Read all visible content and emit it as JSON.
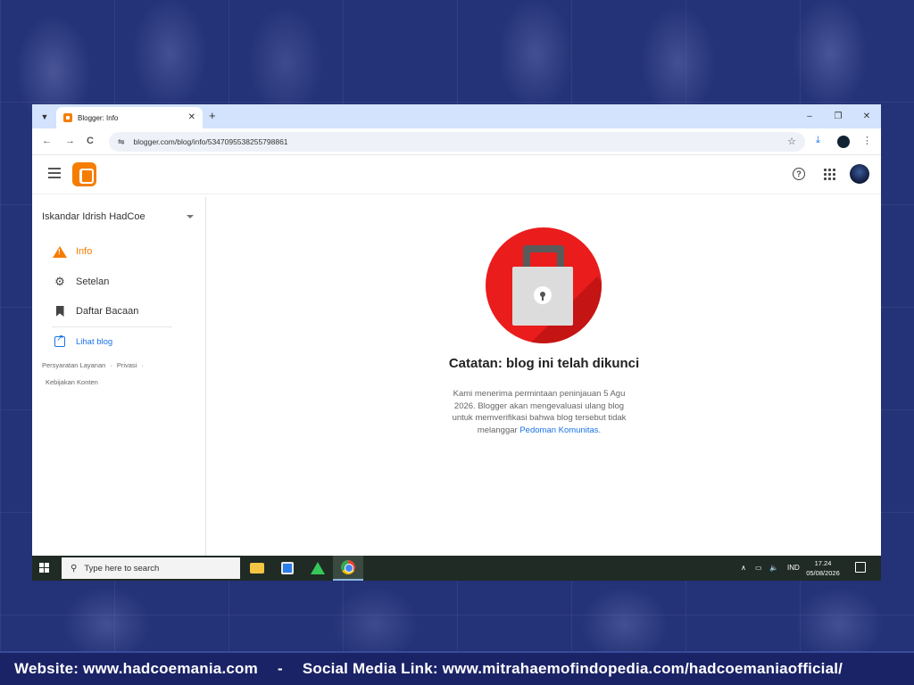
{
  "browser": {
    "tab_title": "Blogger: Info",
    "tab_close": "✕",
    "new_tab": "+",
    "url": "blogger.com/blog/info/5347095538255798861",
    "window_controls": [
      "–",
      "❐",
      "✕"
    ],
    "nav": [
      "←",
      "→",
      "C"
    ]
  },
  "app": {
    "blog_name": "Iskandar Idrish HadCoe",
    "nav_items": [
      {
        "label": "Info",
        "icon": "warning-icon",
        "active": true
      },
      {
        "label": "Setelan",
        "icon": "gear-icon",
        "active": false
      },
      {
        "label": "Daftar Bacaan",
        "icon": "bookmark-icon",
        "active": false
      }
    ],
    "view_blog": "Lihat blog",
    "legal": {
      "terms": "Persyaratan Layanan",
      "privacy": "Privasi",
      "content_policy": "Kebijakan Konten"
    },
    "help_label": "?",
    "accent_color": "#f57d00",
    "link_color": "#1a73e8"
  },
  "locked": {
    "title": "Catatan: blog ini telah dikunci",
    "message": "Kami menerima permintaan peninjauan 5 Agu 2026. Blogger akan mengevaluasi ulang blog untuk memverifikasi bahwa blog tersebut tidak melanggar",
    "link": "Pedoman Komunitas",
    "suffix": ".",
    "lock_color": "#ea1c1c"
  },
  "taskbar": {
    "search_placeholder": "Type here to search",
    "language": "IND",
    "time": "17.24",
    "date": "05/08/2026"
  },
  "footer": {
    "website": "Website: www.hadcoemania.com",
    "separator": "-",
    "social": "Social Media Link: www.mitrahaemofindopedia.com/hadcoemaniaofficial/"
  }
}
